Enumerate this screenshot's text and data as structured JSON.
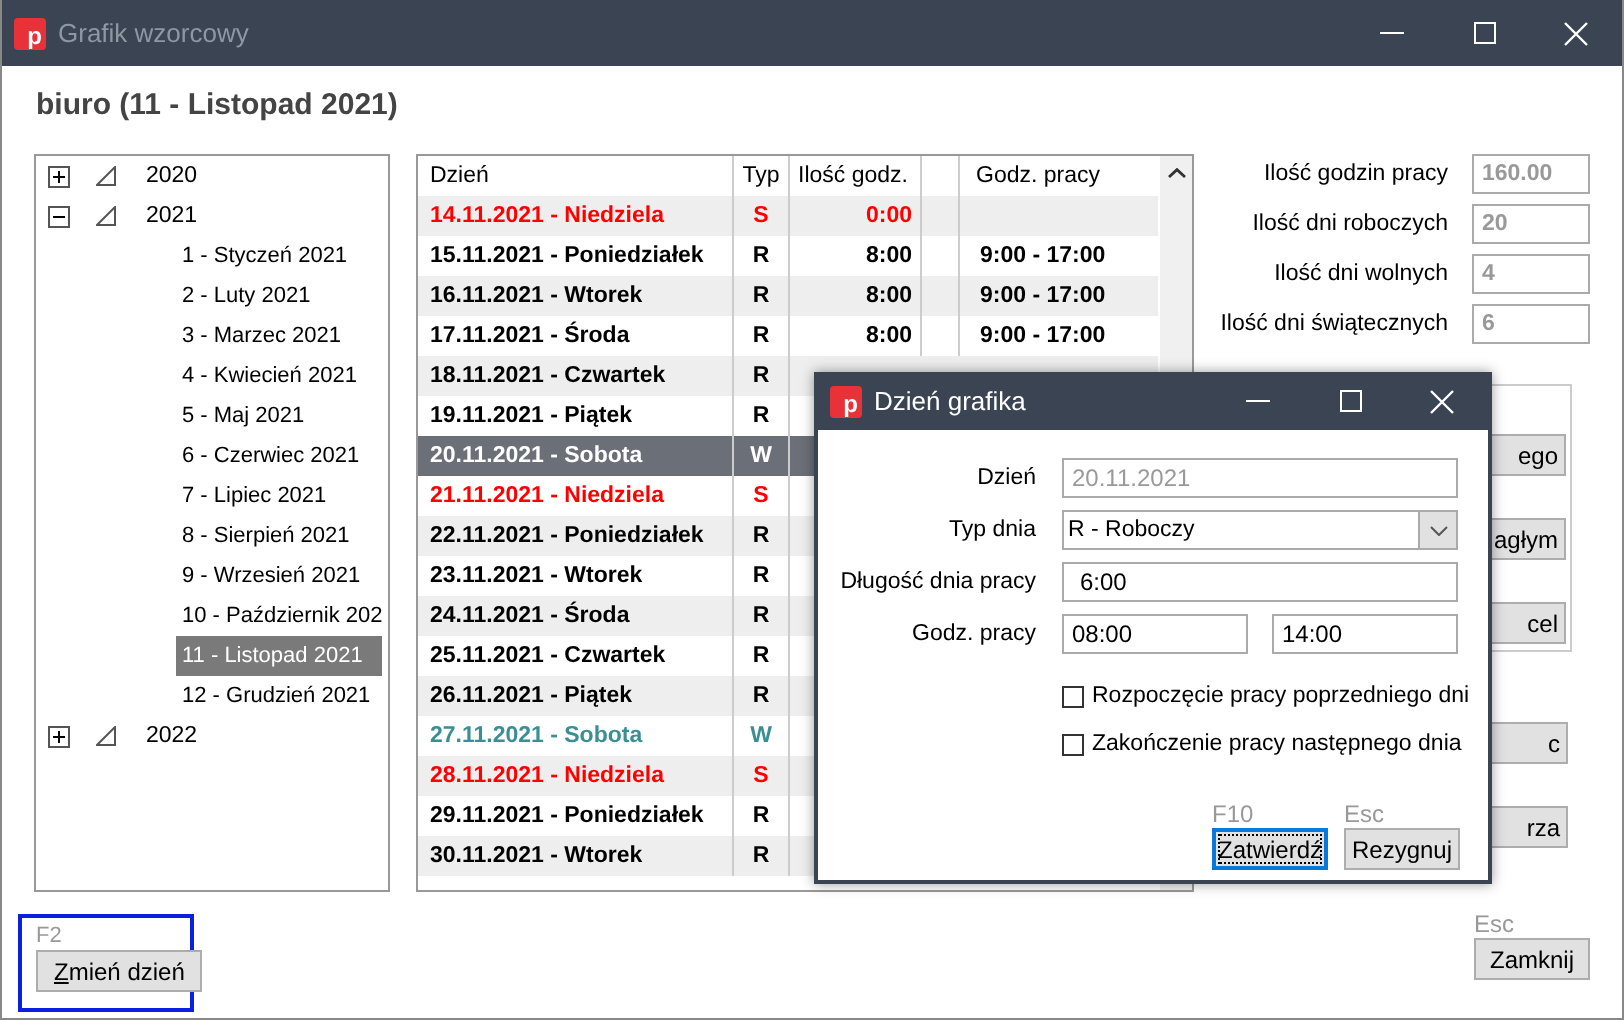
{
  "window": {
    "logo": "p",
    "title": "Grafik wzorcowy"
  },
  "heading": "biuro (11 - Listopad 2021)",
  "tree": [
    {
      "label": "2020",
      "expanded": false,
      "selected": false
    },
    {
      "label": "2021",
      "expanded": true,
      "selected": false,
      "children": [
        {
          "label": "1 - Styczeń 2021",
          "selected": false
        },
        {
          "label": "2 - Luty 2021",
          "selected": false
        },
        {
          "label": "3 - Marzec 2021",
          "selected": false
        },
        {
          "label": "4 - Kwiecień 2021",
          "selected": false
        },
        {
          "label": "5 - Maj 2021",
          "selected": false
        },
        {
          "label": "6 - Czerwiec 2021",
          "selected": false
        },
        {
          "label": "7 - Lipiec 2021",
          "selected": false
        },
        {
          "label": "8 - Sierpień 2021",
          "selected": false
        },
        {
          "label": "9 - Wrzesień 2021",
          "selected": false
        },
        {
          "label": "10 - Październik 202",
          "selected": false
        },
        {
          "label": "11 - Listopad 2021",
          "selected": true
        },
        {
          "label": "12 - Grudzień 2021",
          "selected": false
        }
      ]
    },
    {
      "label": "2022",
      "expanded": false,
      "selected": false
    }
  ],
  "table": {
    "columns": [
      "Dzień",
      "Typ",
      "Ilość godz.",
      "Godz. pracy"
    ],
    "rows": [
      {
        "day": "14.11.2021 - Niedziela",
        "type": "S",
        "kind": "sunday",
        "selected": false,
        "hours": "0:00"
      },
      {
        "day": "15.11.2021 - Poniedziałek",
        "type": "R",
        "kind": "workday",
        "selected": false,
        "hours": "8:00",
        "time": "9:00 - 17:00"
      },
      {
        "day": "16.11.2021 - Wtorek",
        "type": "R",
        "kind": "workday",
        "selected": false,
        "hours": "8:00",
        "time": "9:00 - 17:00"
      },
      {
        "day": "17.11.2021 - Środa",
        "type": "R",
        "kind": "workday",
        "selected": false,
        "hours": "8:00",
        "time": "9:00 - 17:00"
      },
      {
        "day": "18.11.2021 - Czwartek",
        "type": "R",
        "kind": "workday",
        "selected": false
      },
      {
        "day": "19.11.2021 - Piątek",
        "type": "R",
        "kind": "workday",
        "selected": false
      },
      {
        "day": "20.11.2021 - Sobota",
        "type": "W",
        "kind": "saturday",
        "selected": true
      },
      {
        "day": "21.11.2021 - Niedziela",
        "type": "S",
        "kind": "sunday",
        "selected": false
      },
      {
        "day": "22.11.2021 - Poniedziałek",
        "type": "R",
        "kind": "workday",
        "selected": false
      },
      {
        "day": "23.11.2021 - Wtorek",
        "type": "R",
        "kind": "workday",
        "selected": false
      },
      {
        "day": "24.11.2021 - Środa",
        "type": "R",
        "kind": "workday",
        "selected": false
      },
      {
        "day": "25.11.2021 - Czwartek",
        "type": "R",
        "kind": "workday",
        "selected": false
      },
      {
        "day": "26.11.2021 - Piątek",
        "type": "R",
        "kind": "workday",
        "selected": false
      },
      {
        "day": "27.11.2021 - Sobota",
        "type": "W",
        "kind": "saturday",
        "selected": false
      },
      {
        "day": "28.11.2021 - Niedziela",
        "type": "S",
        "kind": "sunday",
        "selected": false
      },
      {
        "day": "29.11.2021 - Poniedziałek",
        "type": "R",
        "kind": "workday",
        "selected": false
      },
      {
        "day": "30.11.2021 - Wtorek",
        "type": "R",
        "kind": "workday",
        "selected": false
      }
    ]
  },
  "summary": [
    {
      "label": "Ilość godzin pracy",
      "value": "160.00"
    },
    {
      "label": "Ilość dni roboczych",
      "value": "20"
    },
    {
      "label": "Ilość dni wolnych",
      "value": "4"
    },
    {
      "label": "Ilość dni świątecznych",
      "value": "6"
    }
  ],
  "side_group": [
    "ego",
    "agłym",
    "cel"
  ],
  "side_buttons": [
    "c",
    "rza"
  ],
  "change_day": {
    "shortcut": "F2",
    "label": "Zmień dzień",
    "focused": true
  },
  "close": {
    "shortcut": "Esc",
    "label": "Zamknij"
  },
  "dialog": {
    "logo": "p",
    "title": "Dzień grafika",
    "fields": [
      {
        "label": "Dzień",
        "kind": "readonly",
        "value": "20.11.2021"
      },
      {
        "label": "Typ dnia",
        "kind": "select",
        "value": "R - Roboczy"
      },
      {
        "label": "Długość dnia pracy",
        "kind": "text",
        "value": "6:00"
      },
      {
        "label": "Godz. pracy",
        "kind": "range",
        "values": [
          "08:00",
          "14:00"
        ]
      }
    ],
    "checkboxes": [
      {
        "label": "Rozpoczęcie pracy poprzedniego dni",
        "checked": false
      },
      {
        "label": "Zakończenie pracy następnego dnia",
        "checked": false
      }
    ],
    "buttons": [
      {
        "shortcut": "F10",
        "label": "Zatwierdź",
        "focused": true
      },
      {
        "shortcut": "Esc",
        "label": "Rezygnuj",
        "focused": false
      }
    ]
  }
}
